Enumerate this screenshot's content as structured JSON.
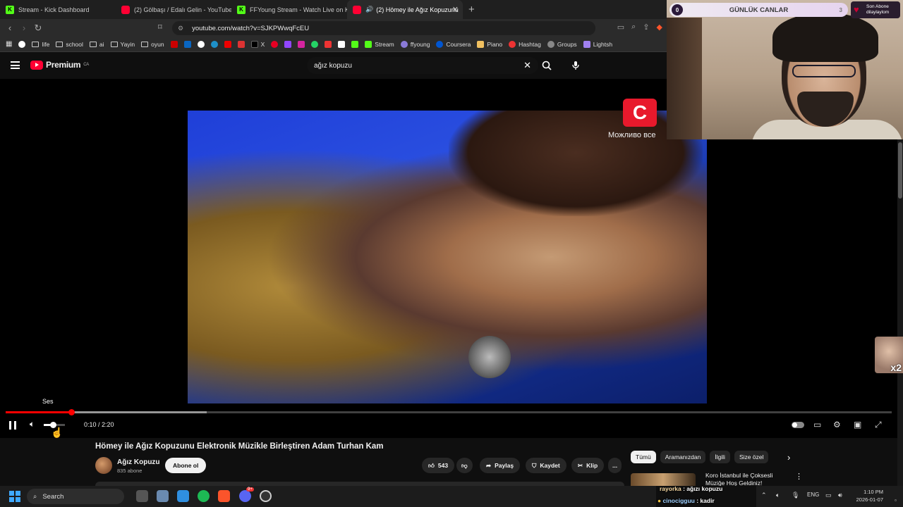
{
  "browser": {
    "tabs": [
      {
        "label": "Stream - Kick Dashboard",
        "icon": "kick-icon"
      },
      {
        "label": "(2) Gölbaşı / Edalı Gelin - YouTube",
        "icon": "youtube-icon"
      },
      {
        "label": "FFYoung Stream - Watch Live on Kick",
        "icon": "kick-icon"
      },
      {
        "label": "(2) Hömey ile Ağız Kopuzunu",
        "icon": "youtube-icon",
        "active": true
      }
    ],
    "url": "youtube.com/watch?v=SJKPWwqFcEU",
    "bookmarks": [
      "life",
      "school",
      "ai",
      "Yayin",
      "oyun",
      "X",
      "Stream",
      "ffyoung",
      "Coursera",
      "Piano",
      "Hashtag",
      "Groups",
      "Lightsh"
    ]
  },
  "youtube": {
    "logo": "Premium",
    "logo_region": "CA",
    "search_query": "ağız kopuzu",
    "player": {
      "tooltip": "Ses",
      "time": "0:10 / 2:20",
      "progress_played": 0.074,
      "progress_buffered": 0.227,
      "volume": 0.43,
      "channel_overlay": "Можливо все"
    },
    "video_title": "Hömey ile Ağız Kopuzunu Elektronik Müzikle Birleştiren Adam Turhan Kam",
    "channel": {
      "name": "Ağız Kopuzu",
      "subs": "835 abone",
      "subscribe_label": "Abone ol"
    },
    "actions": {
      "likes": "543",
      "share": "Paylaş",
      "save": "Kaydet",
      "clip": "Klip",
      "more": "..."
    },
    "chips": [
      "Tümü",
      "Aramanızdan",
      "İlgili",
      "Size özel"
    ],
    "rec_title": "Koro İstanbul ile Çoksesli Müziğe Hoş Geldiniz!"
  },
  "stream_overlay": {
    "goal_title": "GÜNLÜK CANLAR",
    "goal_badge": "0",
    "goal_count": "3",
    "last_sub_label": "Son Abone",
    "last_sub_name": "dilaylaylom",
    "side_multiplier": "x2",
    "chat": [
      {
        "user": "rayorka",
        "message": "ağızı kopuzu"
      },
      {
        "user": "cinocigguu",
        "message": "kadir"
      }
    ]
  },
  "taskbar": {
    "search_label": "Search",
    "lang": "ENG",
    "time": "1:10 PM",
    "date": "2026-01-07",
    "discord_badge": "9+"
  }
}
